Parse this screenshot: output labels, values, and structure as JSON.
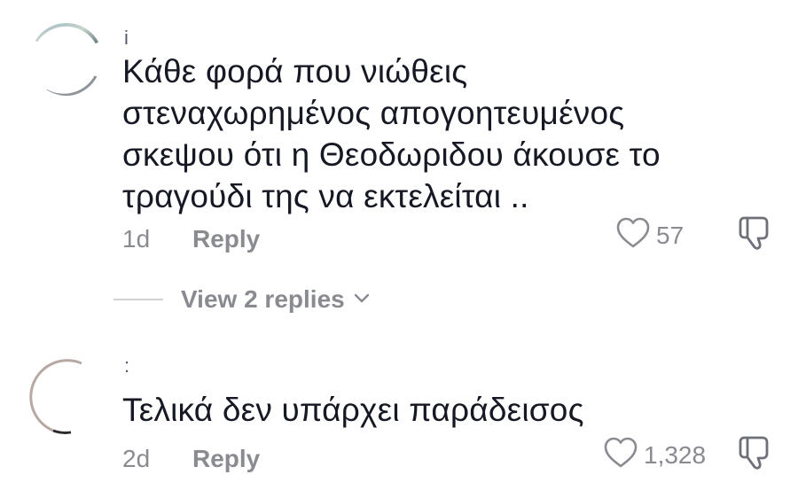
{
  "comments": [
    {
      "username": "i",
      "text": "Κάθε φορά που νιώθεις\nστεναχωρημένος απογοητευμένος\nσκεψου ότι η Θεοδωριδου άκουσε το\nτραγούδι της να εκτελείται ..",
      "age": "1d",
      "reply_label": "Reply",
      "like_count": "57"
    },
    {
      "username": ":",
      "text": "Τελικά δεν υπάρχει παράδεισος",
      "age": "2d",
      "reply_label": "Reply",
      "like_count": "1,328"
    }
  ],
  "view_replies": {
    "label": "View 2 replies"
  },
  "icons": {
    "like": "heart-outline-icon",
    "dislike": "thumbs-down-icon",
    "expand": "chevron-down-icon"
  },
  "colors": {
    "text_primary": "#161823",
    "text_secondary": "#8a8b91",
    "divider": "#d0d1d3"
  }
}
